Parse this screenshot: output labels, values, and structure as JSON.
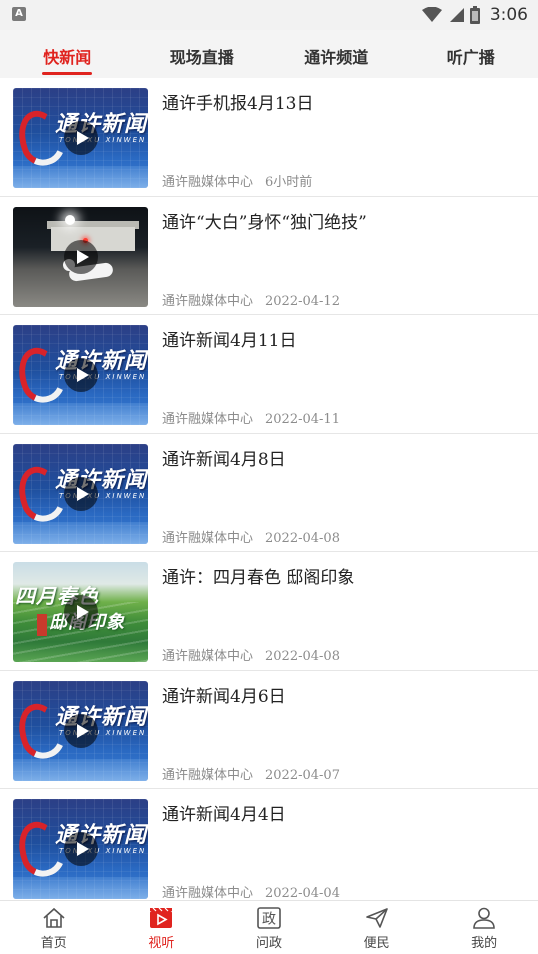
{
  "status_bar": {
    "app_icon": "A",
    "time": "3:06"
  },
  "tabs": [
    {
      "label": "快新闻",
      "active": true
    },
    {
      "label": "现场直播",
      "active": false
    },
    {
      "label": "通许频道",
      "active": false
    },
    {
      "label": "听广播",
      "active": false
    }
  ],
  "thumbnail_text": {
    "tv_logo": "通许新闻",
    "tv_logo_sub": "TONGXU XINWEN",
    "spring_line1": "四月春色",
    "spring_line2": "邸阁印象"
  },
  "news": [
    {
      "title": "通许手机报4月13日",
      "source": "通许融媒体中心",
      "date": "6小时前",
      "thumb": "tv"
    },
    {
      "title": "通许“大白”身怀“独门绝技”",
      "source": "通许融媒体中心",
      "date": "2022-04-12",
      "thumb": "night"
    },
    {
      "title": "通许新闻4月11日",
      "source": "通许融媒体中心",
      "date": "2022-04-11",
      "thumb": "tv"
    },
    {
      "title": "通许新闻4月8日",
      "source": "通许融媒体中心",
      "date": "2022-04-08",
      "thumb": "tv"
    },
    {
      "title": "通许：四月春色 邸阁印象",
      "source": "通许融媒体中心",
      "date": "2022-04-08",
      "thumb": "spring"
    },
    {
      "title": "通许新闻4月6日",
      "source": "通许融媒体中心",
      "date": "2022-04-07",
      "thumb": "tv"
    },
    {
      "title": "通许新闻4月4日",
      "source": "通许融媒体中心",
      "date": "2022-04-04",
      "thumb": "tv"
    }
  ],
  "bottom_nav": [
    {
      "label": "首页",
      "icon": "home-icon",
      "active": false
    },
    {
      "label": "视听",
      "icon": "video-icon",
      "active": true
    },
    {
      "label": "问政",
      "icon": "zheng-icon",
      "active": false
    },
    {
      "label": "便民",
      "icon": "send-icon",
      "active": false
    },
    {
      "label": "我的",
      "icon": "user-icon",
      "active": false
    }
  ],
  "colors": {
    "accent": "#e0241f",
    "meta_text": "#8c8c8c",
    "tab_background": "#f4f4f4"
  }
}
